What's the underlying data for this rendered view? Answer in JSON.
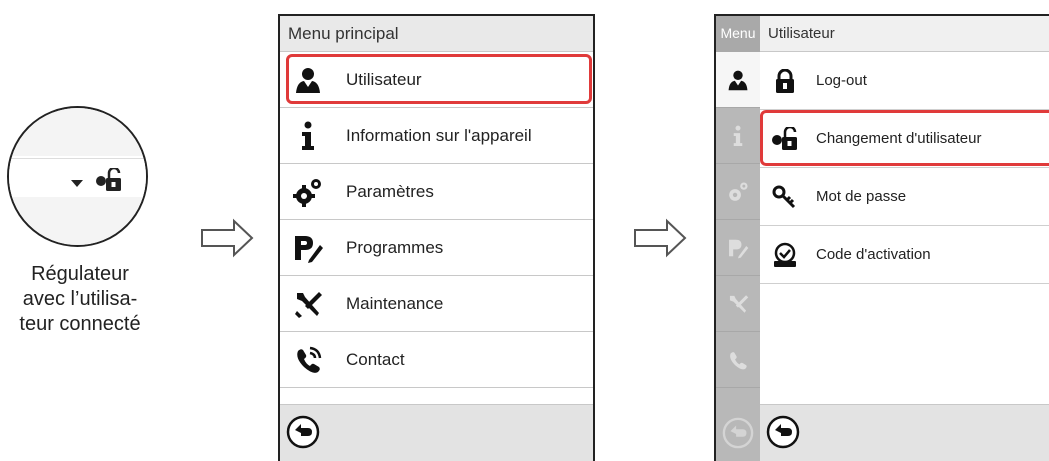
{
  "caption": {
    "line1": "Régulateur",
    "line2": "avec l’utilisa-",
    "line3": "teur connecté"
  },
  "main_menu": {
    "title": "Menu principal",
    "items": [
      {
        "label": "Utilisateur",
        "icon": "user-icon",
        "selected": true
      },
      {
        "label": "Information sur l'appareil",
        "icon": "info-icon",
        "selected": false
      },
      {
        "label": "Paramètres",
        "icon": "settings-gears-icon",
        "selected": false
      },
      {
        "label": "Programmes",
        "icon": "programs-icon",
        "selected": false
      },
      {
        "label": "Maintenance",
        "icon": "maintenance-tools-icon",
        "selected": false
      },
      {
        "label": "Contact",
        "icon": "contact-phone-icon",
        "selected": false
      }
    ]
  },
  "user_menu": {
    "sidebar_title": "Menu",
    "title": "Utilisateur",
    "items": [
      {
        "label": "Log-out",
        "icon": "padlock-icon",
        "selected": false
      },
      {
        "label": "Changement d'utilisateur",
        "icon": "change-user-lock-icon",
        "selected": true
      },
      {
        "label": "Mot de passe",
        "icon": "key-icon",
        "selected": false
      },
      {
        "label": "Code d'activation",
        "icon": "activation-code-icon",
        "selected": false
      }
    ]
  },
  "colors": {
    "highlight": "#e03a3a",
    "footer": "#e3e3e3",
    "sidebar": "#b8b8b8"
  }
}
